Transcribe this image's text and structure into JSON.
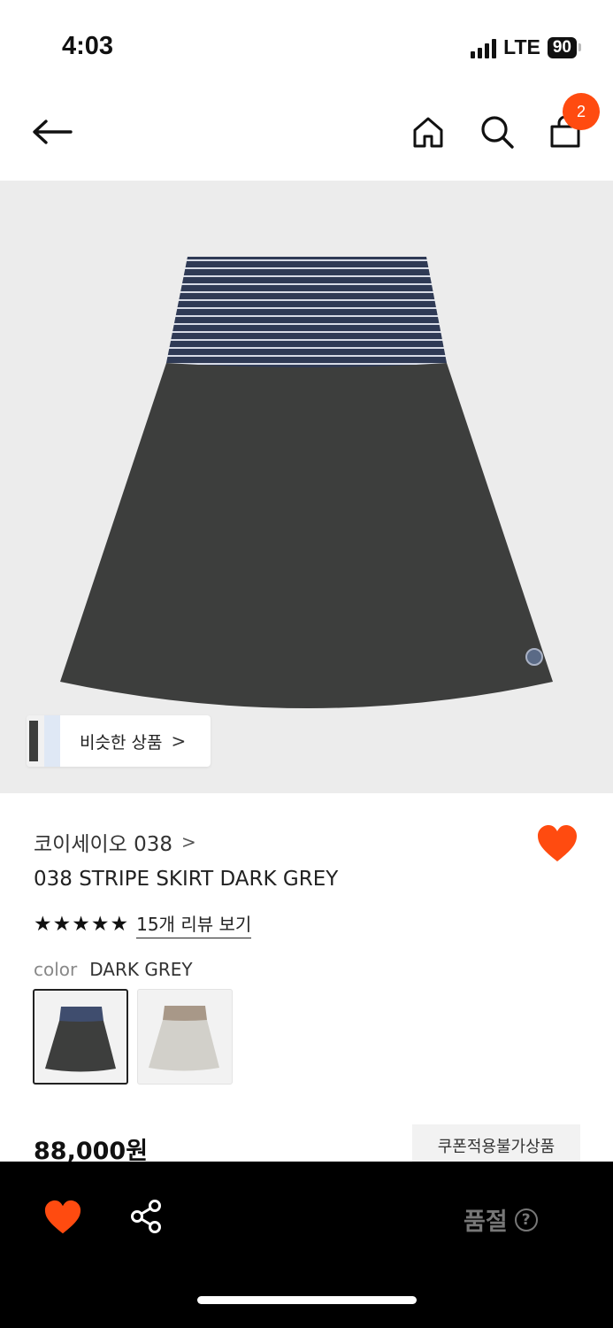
{
  "status_bar": {
    "time": "4:03",
    "network": "LTE",
    "battery": "90"
  },
  "header": {
    "back_icon": "arrow-left-icon",
    "home_icon": "home-icon",
    "search_icon": "search-icon",
    "cart_icon": "shopping-bag-icon",
    "cart_count": "2"
  },
  "gallery": {
    "similar_label": "비슷한 상품",
    "similar_chevron": ">"
  },
  "product": {
    "brand": "코이세이오 038",
    "brand_chevron": ">",
    "name": "038 STRIPE SKIRT DARK GREY",
    "stars": "★★★★★",
    "rating": 5,
    "review_link": "15개 리뷰 보기",
    "color_label": "color",
    "color_value": "DARK GREY",
    "swatches": [
      {
        "name": "DARK GREY",
        "selected": true
      },
      {
        "name": "light grey",
        "selected": false
      }
    ],
    "price": "88,000원",
    "coupon_notice": "쿠폰적용불가상품",
    "wishlisted": true
  },
  "bottom_bar": {
    "wish_icon": "heart-icon",
    "share_icon": "share-icon",
    "status_label": "품절",
    "help_icon": "?"
  },
  "colors": {
    "accent": "#ff4b10",
    "bottom_bar": "#000000",
    "image_bg": "#ececec"
  }
}
